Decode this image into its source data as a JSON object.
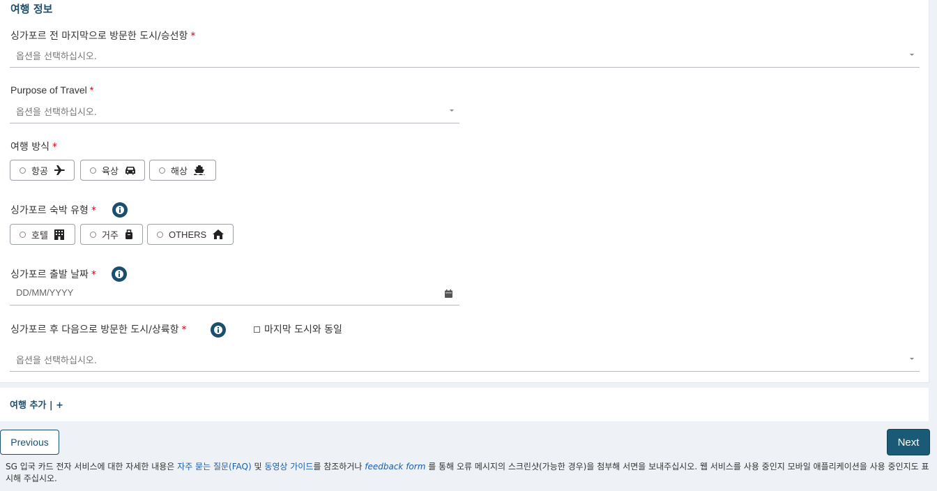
{
  "section": {
    "title": "여행 정보"
  },
  "last_city": {
    "label": "싱가포르 전 마지막으로 방문한 도시/승선항",
    "required": "*",
    "placeholder": "옵션을 선택하십시오."
  },
  "purpose": {
    "label": "Purpose of Travel",
    "required": "*",
    "placeholder": "옵션을 선택하십시오."
  },
  "travel_mode": {
    "label": "여행 방식",
    "required": "*",
    "options": [
      {
        "label": "항공",
        "icon": "plane-icon"
      },
      {
        "label": "육상",
        "icon": "car-icon"
      },
      {
        "label": "해상",
        "icon": "ship-icon"
      }
    ]
  },
  "accommodation": {
    "label": "싱가포르 숙박 유형",
    "required": "*",
    "options": [
      {
        "label": "호텔",
        "icon": "hotel-icon"
      },
      {
        "label": "거주",
        "icon": "luggage-icon"
      },
      {
        "label": "OTHERS",
        "icon": "home-icon"
      }
    ]
  },
  "departure_date": {
    "label": "싱가포르 출발 날짜",
    "required": "*",
    "placeholder": "DD/MM/YYYY"
  },
  "next_city": {
    "label": "싱가포르 후 다음으로 방문한 도시/상륙항",
    "required": "*",
    "same_checkbox_label": "마지막 도시와 동일",
    "placeholder": "옵션을 선택하십시오."
  },
  "add_trip": {
    "label": "여행 추가 | +"
  },
  "buttons": {
    "previous": "Previous",
    "next": "Next"
  },
  "footer": {
    "text1": "SG 입국 카드 전자 서비스에 대한 자세한 내용은 ",
    "faq_link": "자주 묻는 질문(FAQ)",
    "text2": " 및 ",
    "video_link": "동영상 가이드",
    "text3": "를 참조하거나 ",
    "feedback_link": "feedback form",
    "text4": " 를 통해 오류 메시지의 스크린샷(가능한 경우)을 첨부해 서면을 보내주십시오. 웹 서비스를 사용 중인지 모바일 애플리케이션을 사용 중인지도 표시해 주십시오."
  },
  "colors": {
    "accent": "#1b4f6e",
    "required": "#d0021b",
    "link": "#1b5ea8"
  }
}
